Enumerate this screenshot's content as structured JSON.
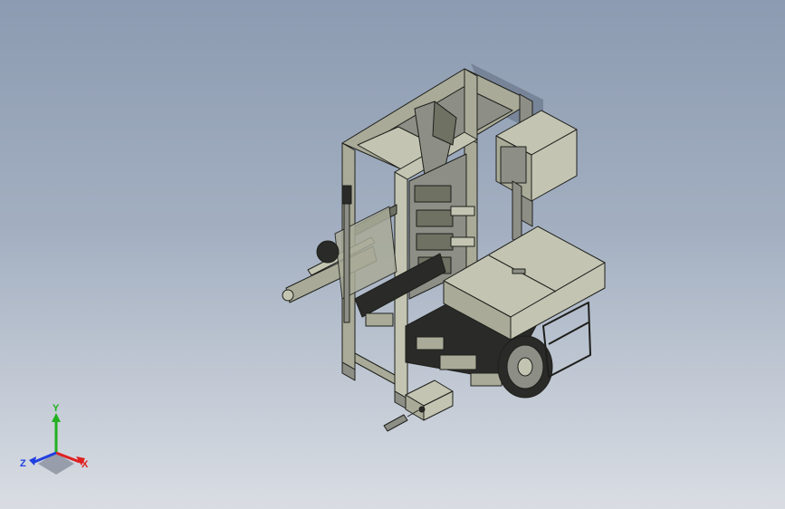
{
  "triad": {
    "labels": {
      "x": "X",
      "y": "Y",
      "z": "Z"
    },
    "colors": {
      "x": "#e02020",
      "y": "#20b020",
      "z": "#2040e0"
    }
  },
  "model": {
    "colors": {
      "body": "#a9ab98",
      "body_light": "#c3c5b2",
      "body_dark": "#6f7163",
      "edge": "#1e1f1b",
      "shadow": "#5f6c80",
      "belt": "#2a2b28",
      "metal": "#8d8f86"
    }
  }
}
